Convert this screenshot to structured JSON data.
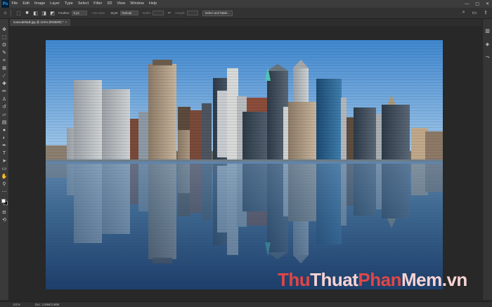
{
  "app": {
    "logo": "Ps"
  },
  "menu": [
    "File",
    "Edit",
    "Image",
    "Layer",
    "Type",
    "Select",
    "Filter",
    "3D",
    "View",
    "Window",
    "Help"
  ],
  "window_controls": {
    "minimize": "—",
    "maximize": "▢",
    "close": "✕"
  },
  "options": {
    "feather_label": "Feather:",
    "feather_value": "0 px",
    "antialias_label": "Anti-alias",
    "style_label": "Style:",
    "style_value": "Normal",
    "width_label": "Width:",
    "height_label": "Height:",
    "select_mask_label": "Select and Mask..."
  },
  "document": {
    "tab_title": "nuevodefault.jpg @ 121% (RGB/8#) *",
    "close_glyph": "×"
  },
  "status": {
    "zoom": "121%",
    "doc_size": "Doc: 2.86M/2.86M"
  },
  "watermark": {
    "part1": "Thu",
    "part2": "Thuat",
    "part3": "Phan",
    "part4": "Mem.vn"
  },
  "icons": {
    "marquee": "rect-marquee-icon",
    "move": "move-icon",
    "search": "search-icon",
    "workspace": "workspace-icon",
    "share": "share-icon"
  }
}
